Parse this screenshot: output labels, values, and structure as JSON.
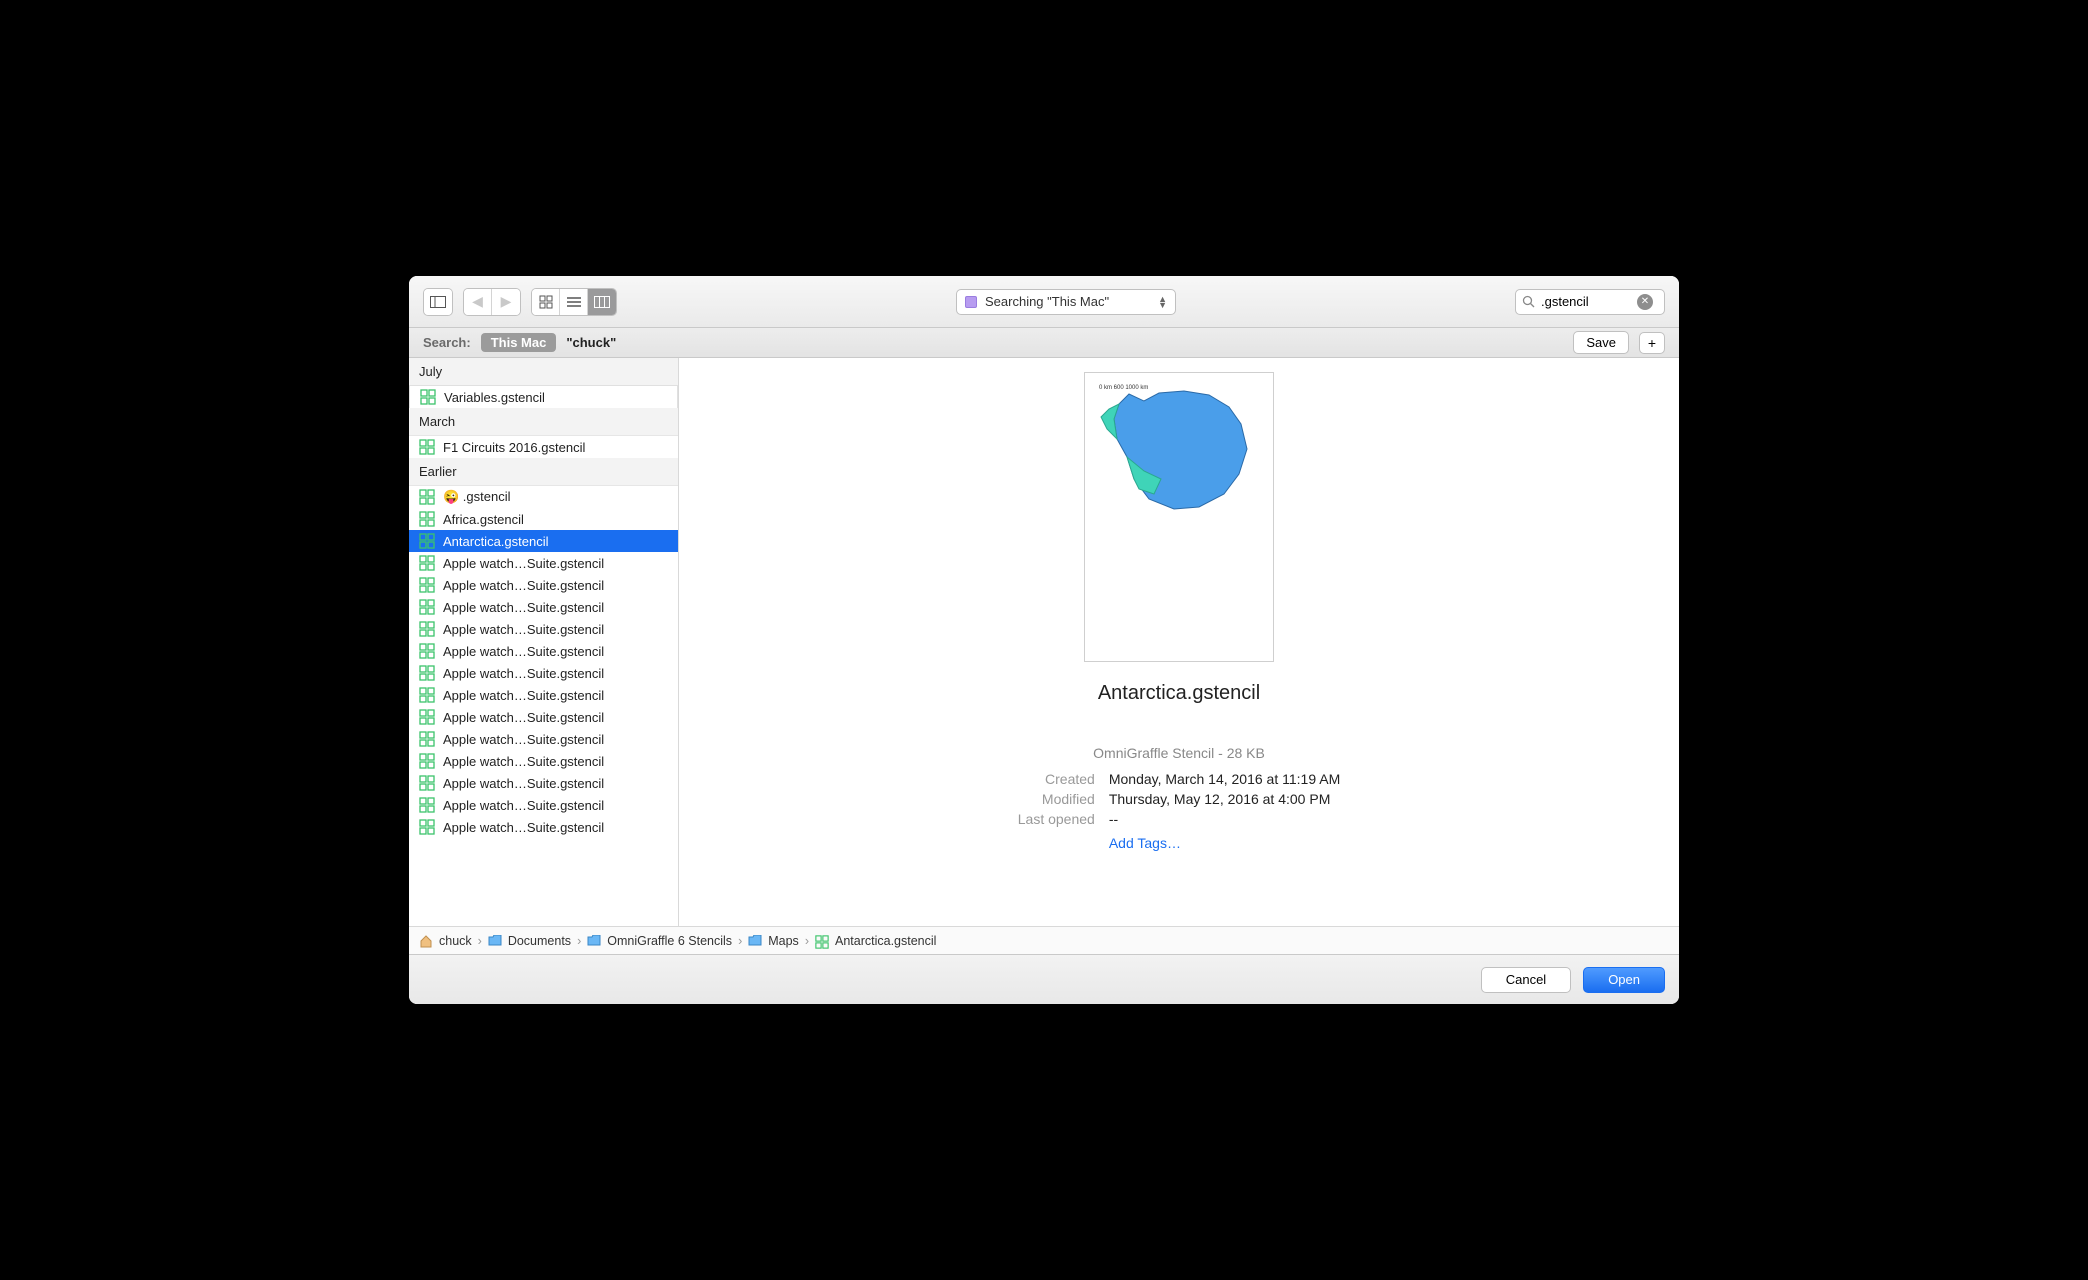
{
  "toolbar": {
    "dropdown_text": "Searching \"This Mac\""
  },
  "search": {
    "value": ".gstencil"
  },
  "scope": {
    "label": "Search:",
    "active": "This Mac",
    "other": "\"chuck\"",
    "save": "Save"
  },
  "sections": [
    {
      "header": "July",
      "items": [
        {
          "name": "Variables.gstencil",
          "boxed": true
        }
      ]
    },
    {
      "header": "March",
      "items": [
        {
          "name": "F1 Circuits 2016.gstencil"
        }
      ]
    },
    {
      "header": "Earlier",
      "items": [
        {
          "name": "😜 .gstencil"
        },
        {
          "name": "Africa.gstencil"
        },
        {
          "name": "Antarctica.gstencil",
          "selected": true
        },
        {
          "name": "Apple watch…Suite.gstencil"
        },
        {
          "name": "Apple watch…Suite.gstencil"
        },
        {
          "name": "Apple watch…Suite.gstencil"
        },
        {
          "name": "Apple watch…Suite.gstencil"
        },
        {
          "name": "Apple watch…Suite.gstencil"
        },
        {
          "name": "Apple watch…Suite.gstencil"
        },
        {
          "name": "Apple watch…Suite.gstencil"
        },
        {
          "name": "Apple watch…Suite.gstencil"
        },
        {
          "name": "Apple watch…Suite.gstencil"
        },
        {
          "name": "Apple watch…Suite.gstencil"
        },
        {
          "name": "Apple watch…Suite.gstencil"
        },
        {
          "name": "Apple watch…Suite.gstencil"
        },
        {
          "name": "Apple watch…Suite.gstencil"
        }
      ]
    }
  ],
  "preview": {
    "title": "Antarctica.gstencil",
    "sub": "OmniGraffle Stencil - 28 KB",
    "created_label": "Created",
    "created": "Monday, March 14, 2016 at 11:19 AM",
    "modified_label": "Modified",
    "modified": "Thursday, May 12, 2016 at 4:00 PM",
    "lastopened_label": "Last opened",
    "lastopened": "--",
    "add_tags": "Add Tags…"
  },
  "path": [
    "chuck",
    "Documents",
    "OmniGraffle 6 Stencils",
    "Maps",
    "Antarctica.gstencil"
  ],
  "footer": {
    "cancel": "Cancel",
    "open": "Open"
  }
}
